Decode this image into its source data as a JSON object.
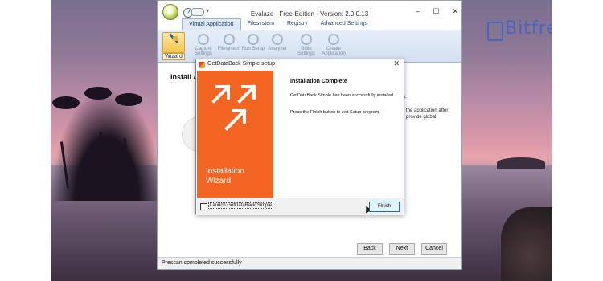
{
  "window": {
    "title": "Evalaze - Free-Edition - Version: 2.0.0.13",
    "caption_minimize": "–",
    "caption_maximize": "☐",
    "caption_close": "✕",
    "quick_access_help": "?",
    "quick_access_dropdown": "▾"
  },
  "tabs": [
    {
      "label": "Virtual Application",
      "active": true
    },
    {
      "label": "Filesystem",
      "active": false
    },
    {
      "label": "Registry",
      "active": false
    },
    {
      "label": "Advanced Settings",
      "active": false
    }
  ],
  "ribbon": {
    "wizard_label": "Wizard",
    "tools": [
      {
        "label": "Capture Settings",
        "icon": "wrench-icon"
      },
      {
        "label": "Filesystem",
        "icon": "magnifier-icon"
      },
      {
        "label": "Run Setup",
        "icon": "magnifier-icon"
      },
      {
        "label": "Analyzer",
        "icon": "magnifier-icon"
      },
      {
        "label": "Build Settings",
        "icon": "gear-icon"
      },
      {
        "label": "Create Application",
        "icon": "disk-icon"
      }
    ]
  },
  "content": {
    "heading": "Install Ap",
    "right_text_1": "w.",
    "right_text_2": "e the application after",
    "right_text_3": "d provide global"
  },
  "buttons": {
    "back": "Back",
    "next": "Next",
    "cancel": "Cancel"
  },
  "status": "Prescan completed successfully",
  "dialog": {
    "title": "GetDataBack Simple setup",
    "close": "✕",
    "panel_line1": "Installation",
    "panel_line2": "Wizard",
    "heading": "Installation Complete",
    "message1": "GetDataBack Simple has been successfully installed.",
    "message2": "Press the Finish button to exit Setup program.",
    "checkbox_label": "Launch GetDataBack Simple",
    "checkbox_checked": false,
    "finish": "Finish",
    "accent_color": "#f26522"
  },
  "watermark": {
    "text": "Bitfrec",
    "color": "#3b63c6"
  }
}
